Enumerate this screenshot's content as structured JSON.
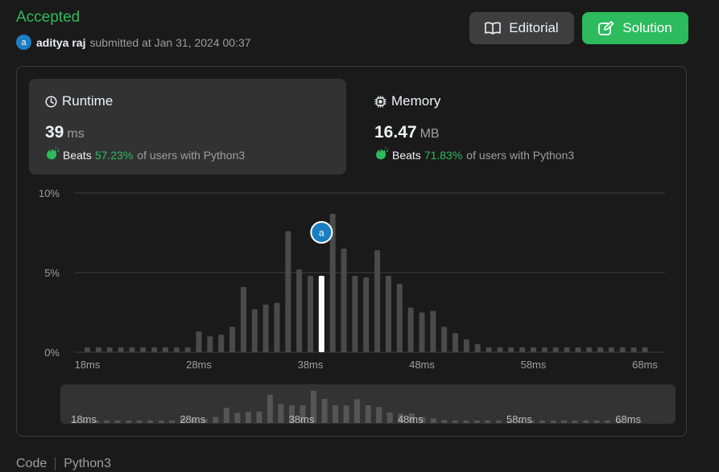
{
  "header": {
    "status": "Accepted",
    "avatar_letter": "a",
    "username": "aditya raj",
    "submitted_text": "submitted at Jan 31, 2024 00:37",
    "editorial_label": "Editorial",
    "solution_label": "Solution"
  },
  "runtime": {
    "title": "Runtime",
    "value": "39",
    "unit": "ms",
    "beats_label": "Beats",
    "beats_pct": "57.23%",
    "beats_suffix": "of users with Python3"
  },
  "memory": {
    "title": "Memory",
    "value": "16.47",
    "unit": "MB",
    "beats_label": "Beats",
    "beats_pct": "71.83%",
    "beats_suffix": "of users with Python3"
  },
  "chart_data": {
    "type": "bar",
    "x": [
      18,
      19,
      20,
      21,
      22,
      23,
      24,
      25,
      26,
      27,
      28,
      29,
      30,
      31,
      32,
      33,
      34,
      35,
      36,
      37,
      38,
      39,
      40,
      41,
      42,
      43,
      44,
      45,
      46,
      47,
      48,
      49,
      50,
      51,
      52,
      53,
      54,
      55,
      56,
      57,
      58,
      59,
      60,
      61,
      62,
      63,
      64,
      65,
      66,
      67,
      68
    ],
    "values": [
      0.3,
      0.3,
      0.3,
      0.3,
      0.3,
      0.3,
      0.3,
      0.3,
      0.3,
      0.3,
      1.3,
      1.0,
      1.1,
      1.6,
      4.1,
      2.7,
      3.0,
      3.1,
      7.6,
      5.2,
      4.8,
      4.8,
      8.7,
      6.5,
      4.8,
      4.7,
      6.4,
      4.8,
      4.3,
      2.8,
      2.5,
      2.6,
      1.6,
      1.2,
      0.8,
      0.5,
      0.3,
      0.3,
      0.3,
      0.3,
      0.3,
      0.3,
      0.3,
      0.3,
      0.3,
      0.3,
      0.3,
      0.3,
      0.3,
      0.3,
      0.3
    ],
    "highlight_x": 39,
    "marker_label": "a",
    "y_ticks": [
      "10%",
      "5%",
      "0%"
    ],
    "y_tick_values": [
      10,
      5,
      0
    ],
    "x_tick_labels": [
      "18ms",
      "28ms",
      "38ms",
      "48ms",
      "58ms",
      "68ms"
    ],
    "x_tick_values": [
      18,
      28,
      38,
      48,
      58,
      68
    ],
    "ylim": [
      0,
      10
    ],
    "grid": true,
    "colors": {
      "bar": "#4a4a4a",
      "highlight": "#ffffff",
      "grid": "#3e3e3e",
      "marker": "#1a7fc1"
    }
  },
  "footer": {
    "code_label": "Code",
    "language": "Python3"
  }
}
